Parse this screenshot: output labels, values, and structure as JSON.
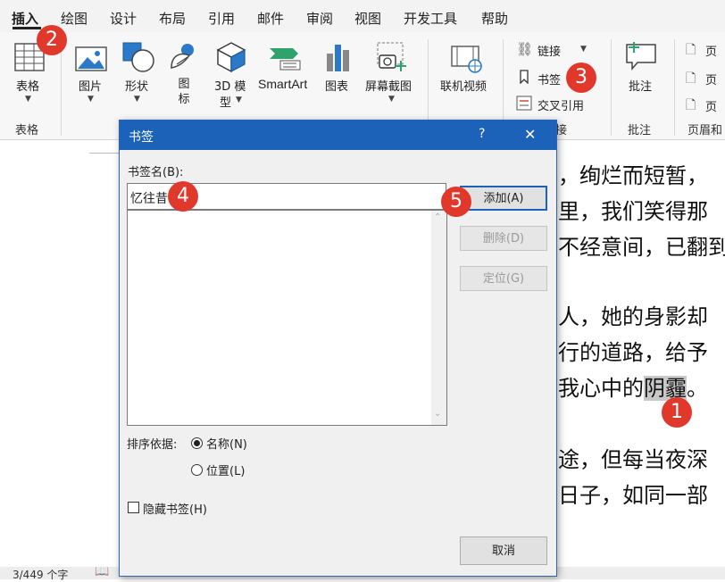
{
  "ribbon": {
    "tabs": [
      "插入",
      "绘图",
      "设计",
      "布局",
      "引用",
      "邮件",
      "审阅",
      "视图",
      "开发工具",
      "帮助"
    ],
    "active_tab": "插入",
    "table_btn": "表格",
    "table_group": "表格",
    "picture_btn": "图片",
    "shapes_btn": "形状",
    "icons_btn": "图标",
    "model3d_btn_line1": "3D 模",
    "model3d_btn_line2": "型",
    "smartart_btn": "SmartArt",
    "chart_btn": "图表",
    "screenshot_btn": "屏幕截图",
    "online_video_btn": "联机视频",
    "link_btn": "链接",
    "bookmark_btn": "书签",
    "crossref_btn": "交叉引用",
    "links_group": "接",
    "comment_btn": "批注",
    "comments_group": "批注",
    "header_btn": "页",
    "footer_btn": "页",
    "pagenum_btn": "页",
    "header_group": "页眉和"
  },
  "document": {
    "lines": [
      {
        "text": "，绚烂而短暂，"
      },
      {
        "text": "里，我们笑得那"
      },
      {
        "text": "不经意间，已翻到"
      },
      {
        "text": "人，她的身影却"
      },
      {
        "text": "行的道路，给予"
      },
      {
        "text": "我心中的",
        "highlight": "阴霾",
        "after": "。"
      },
      {
        "text": "途，但每当夜深"
      },
      {
        "text": "日子，如同一部"
      }
    ]
  },
  "statusbar": {
    "word_count": "3/449 个字"
  },
  "dialog": {
    "title": "书签",
    "help": "?",
    "close": "✕",
    "name_label": "书签名(B):",
    "name_value": "忆往昔",
    "add_btn": "添加(A)",
    "delete_btn": "删除(D)",
    "goto_btn": "定位(G)",
    "sort_label": "排序依据:",
    "sort_name": "名称(N)",
    "sort_location": "位置(L)",
    "hidden_label": "隐藏书签(H)",
    "cancel_btn": "取消"
  },
  "badges": [
    "1",
    "2",
    "3",
    "4",
    "5"
  ],
  "colors": {
    "accent": "#1c62b9",
    "badge": "#e0392c",
    "highlight": "#c8c8c8"
  }
}
